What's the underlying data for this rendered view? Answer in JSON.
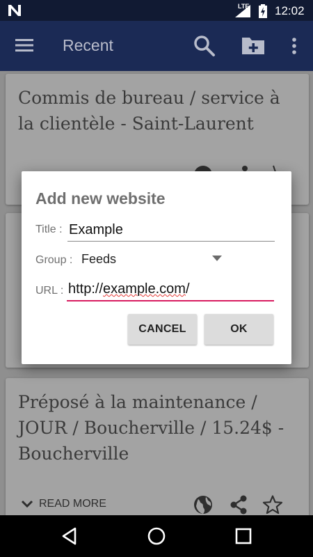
{
  "status_bar": {
    "network": "LTE",
    "time": "12:02"
  },
  "app_bar": {
    "title": "Recent",
    "icons": [
      "menu-icon",
      "search-icon",
      "add-folder-icon",
      "overflow-menu-icon"
    ]
  },
  "cards": [
    {
      "title": "Commis de bureau / service à la clientèle - Saint-Laurent"
    },
    {
      "title": ""
    },
    {
      "title": "Préposé à la maintenance / JOUR / Boucherville / 15.24$ - Boucherville",
      "read_more": "READ MORE"
    }
  ],
  "dialog": {
    "title": "Add new website",
    "title_label": "Title :",
    "title_value": "Example",
    "group_label": "Group :",
    "group_value": "Feeds",
    "url_label": "URL :",
    "url_prefix": "http://",
    "url_highlight": "example.com",
    "url_suffix": "/",
    "cancel_label": "CANCEL",
    "ok_label": "OK"
  },
  "colors": {
    "app_bar": "#1b2a55",
    "status_bar": "#111a33",
    "accent": "#d81b60",
    "scrim_background": "#8f8f8f"
  }
}
